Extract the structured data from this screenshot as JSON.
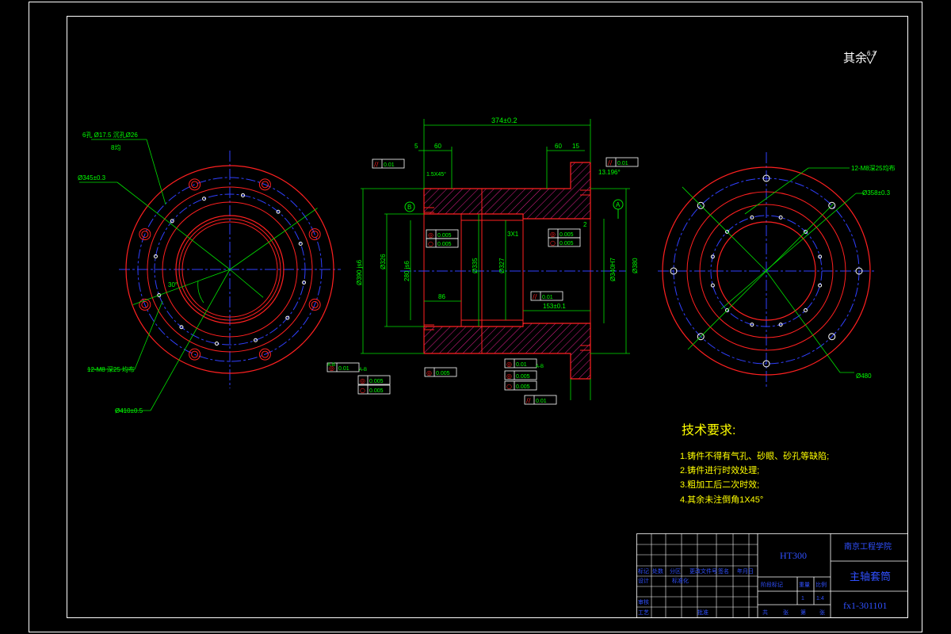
{
  "surface_note": "其余",
  "surface_value": "6.3",
  "left_view": {
    "label_holes": "6孔 Ø17.5 沉孔Ø26",
    "label_holes_sub": "8均",
    "label_d345": "Ø345±0.3",
    "label_m8": "12-M8 深25 均布",
    "label_d410": "Ø410±0.5",
    "label_angle": "30°"
  },
  "right_view": {
    "label_m8": "12-M8深25均布",
    "label_d358": "Ø358±0.3",
    "label_d480": "Ø480"
  },
  "section": {
    "dim_total": "374±0.2",
    "dim_60a": "60",
    "dim_60b": "60",
    "dim_5": "5",
    "dim_15": "15",
    "dim_86": "86",
    "dim_153": "153±0.1",
    "dim_3x1": "3X1",
    "dim_2": "2",
    "chamfer_left": "1.5X45°",
    "chamfer_right": "13.196°",
    "label_A": "A",
    "label_B": "B",
    "d_390": "Ø390 js6",
    "d_326": "Ø326",
    "d_280": "280 js6",
    "d_335": "Ø335",
    "d_327": "Ø327",
    "d_340": "Ø340H7",
    "d_380": "Ø380",
    "tol_flat_top": "0.01",
    "tol_top_right": "0.01",
    "tol_mid_left_1": "0.005",
    "tol_mid_left_2": "0.005",
    "tol_mid_right_1": "0.005",
    "tol_mid_right_2": "0.005",
    "tol_mid_flat": "0.01",
    "tol_bl_1": "0.01",
    "tol_bl_2": "0.005",
    "tol_bl_3": "0.005",
    "tol_bm": "0.005",
    "tol_br_1": "0.01",
    "tol_br_2": "0.005",
    "tol_br_3": "0.005",
    "tol_bottom": "0.01",
    "ref_ab": "A-B"
  },
  "tech_req": {
    "title": "技术要求:",
    "items": [
      "1.铸件不得有气孔、砂眼、砂孔等缺陷;",
      "2.铸件进行时效处理;",
      "3.粗加工后二次时效;",
      "4.其余未注倒角1X45°"
    ]
  },
  "title_block": {
    "material": "HT300",
    "school": "南京工程学院",
    "part_name": "主轴套筒",
    "drawing_no": "fx1-301101",
    "row_a": [
      "标记",
      "处数",
      "分区",
      "更改文件号",
      "签名",
      "年月日"
    ],
    "row_b": [
      "设计",
      "",
      "标准化",
      "",
      "阶段标记",
      "重量",
      "比例"
    ],
    "row_c": [
      "审核"
    ],
    "row_d": [
      "工艺",
      "",
      "批准",
      "共",
      "张",
      "第",
      "张"
    ],
    "scale": "1:4",
    "weight": "1"
  },
  "colors": {
    "frame": "#ffffff",
    "outline": "#ff2020",
    "center": "#3040ff",
    "dimension": "#00e000",
    "hatch": "#e0208c",
    "text": "#00ff00",
    "title": "#3050ff",
    "yellow": "#ffff00"
  }
}
